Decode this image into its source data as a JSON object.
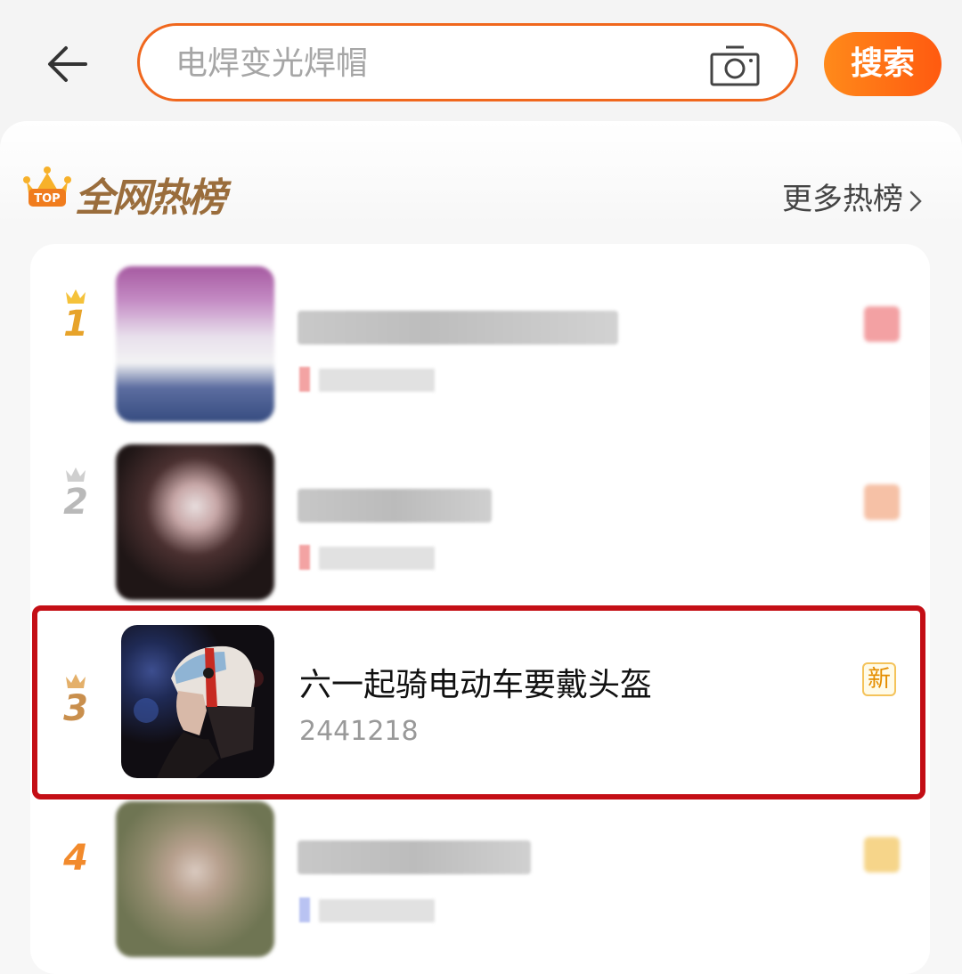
{
  "search": {
    "placeholder": "电焊变光焊帽",
    "button_label": "搜索"
  },
  "board": {
    "title": "全网热榜",
    "badge_text": "TOP",
    "more_label": "更多热榜"
  },
  "items": [
    {
      "rank": "1",
      "title": "",
      "heat": "",
      "badge": ""
    },
    {
      "rank": "2",
      "title": "",
      "heat": "",
      "badge": ""
    },
    {
      "rank": "3",
      "title": "六一起骑电动车要戴头盔",
      "heat": "2441218",
      "badge": "新"
    },
    {
      "rank": "4",
      "title": "",
      "heat": "",
      "badge": ""
    }
  ],
  "colors": {
    "accent": "#f0671d",
    "rank_gold": "#e7a32a",
    "rank_silver": "#b9b9b9",
    "rank_bronze": "#c98f4d",
    "rank_4": "#f28a2c",
    "highlight_border": "#c40f16"
  },
  "icons": {
    "back": "arrow-left-icon",
    "camera": "camera-icon",
    "chevron": "chevron-right-icon",
    "crown": "crown-icon"
  }
}
